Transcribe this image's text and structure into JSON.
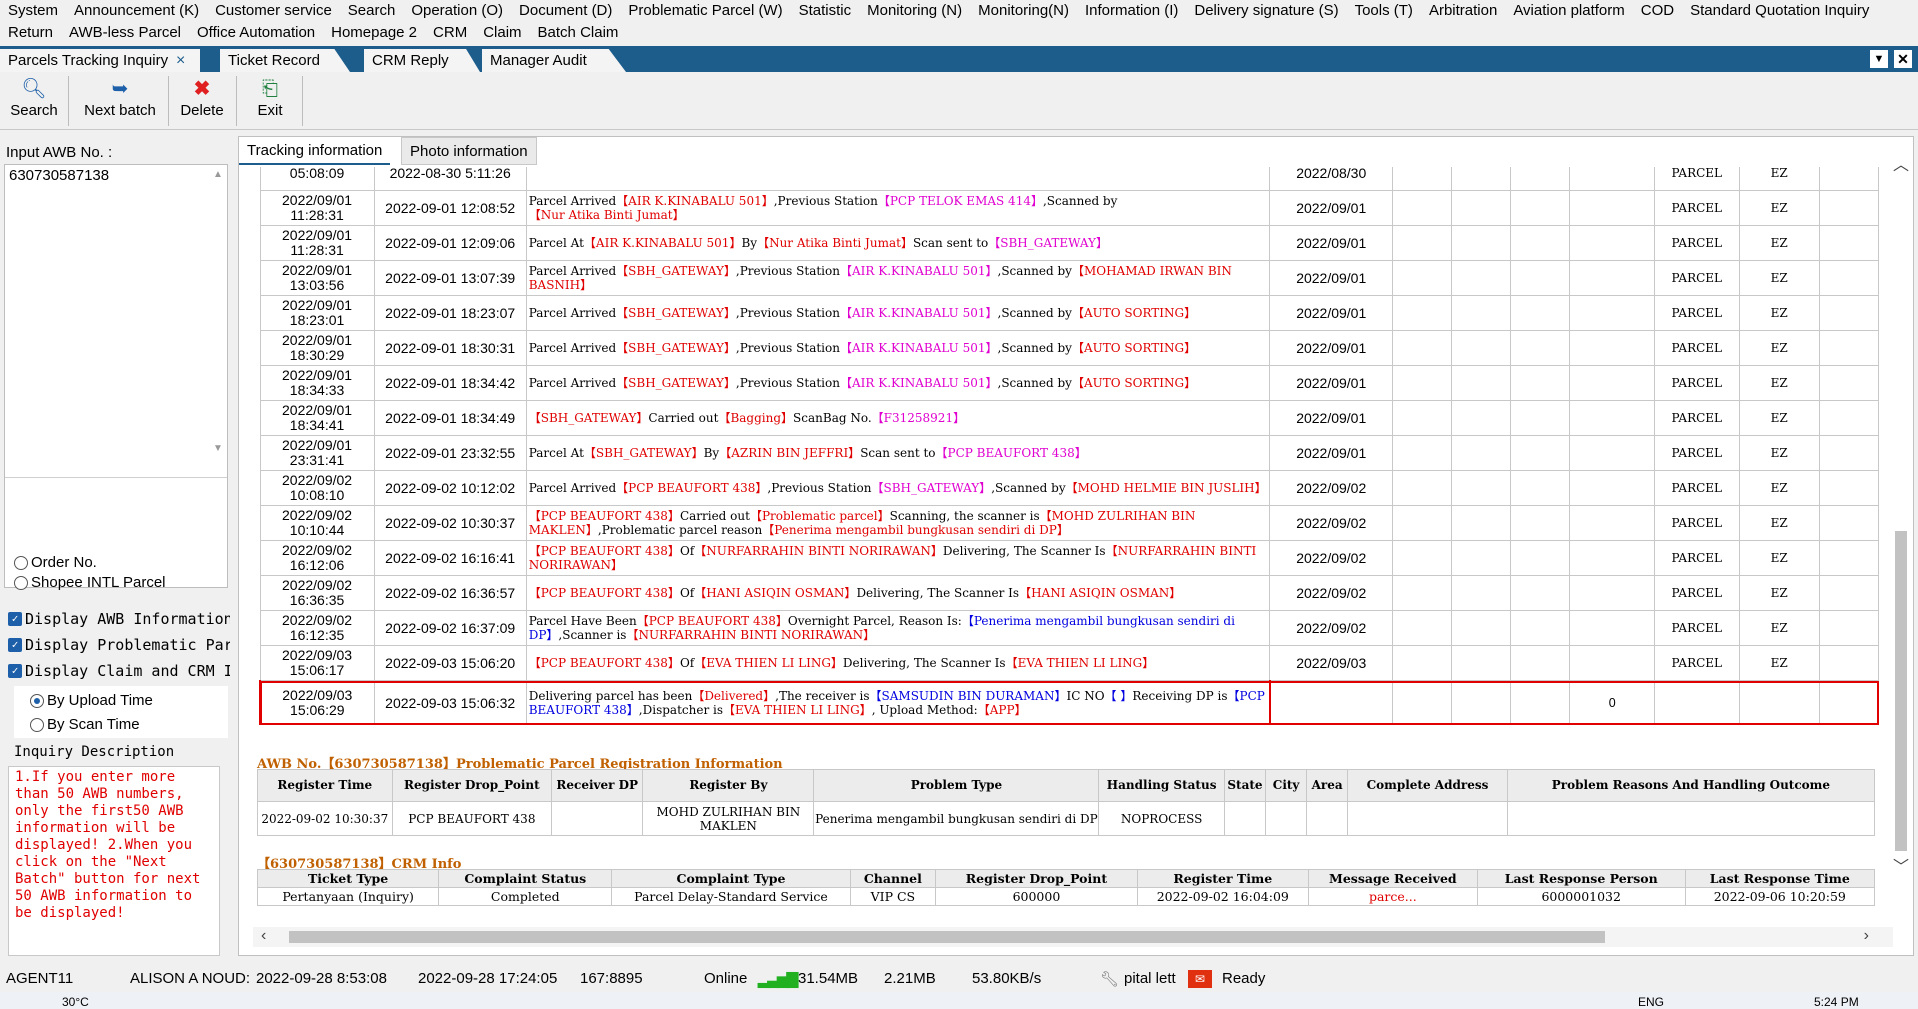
{
  "menu": {
    "row1": [
      "System",
      "Announcement (K)",
      "Customer service",
      "Search",
      "Operation (O)",
      "Document (D)",
      "Problematic Parcel (W)",
      "Statistic",
      "Monitoring (N)",
      "Monitoring(N)",
      "Information (I)",
      "Delivery signature (S)",
      "Tools (T)",
      "Arbitration",
      "Aviation platform",
      "COD",
      "Standard Quotation Inquiry"
    ],
    "row2": [
      "Return",
      "AWB-less Parcel",
      "Office Automation",
      "Homepage 2",
      "CRM",
      "Claim",
      "Batch Claim"
    ]
  },
  "tabs": {
    "active": "Parcels Tracking Inquiry",
    "others": [
      "Ticket Record",
      "CRM Reply",
      "Manager Audit"
    ],
    "close_icon": "×"
  },
  "toolbar": {
    "search": "Search",
    "next_batch": "Next batch",
    "delete": "Delete",
    "exit": "Exit"
  },
  "left": {
    "awb_label": "Input AWB No. :",
    "awb_value": "630730587138",
    "order_no": "Order No.",
    "shopee": "Shopee INTL Parcel",
    "chk_awb": "Display AWB Information",
    "chk_problematic": "Display Problematic Par",
    "chk_claim": "Display Claim and CRM I",
    "by_upload": "By Upload Time",
    "by_scan": "By Scan Time",
    "inquiry_title": "Inquiry Description",
    "inquiry_text": "1.If you enter more than  50  AWB numbers, only the first50  AWB information will be displayed! 2.When you click on the \"Next Batch\" button for next  50  AWB information to be displayed!"
  },
  "subtabs": [
    "Tracking information",
    "Photo information"
  ],
  "tracking": {
    "partial_row": {
      "upload": "05:08:09",
      "scan": "2022-08-30 5:11:26",
      "date": "2022/08/30",
      "type": "PARCEL",
      "code": "EZ"
    },
    "rows": [
      {
        "upload1": "2022/09/01",
        "upload2": "11:28:31",
        "scan": "2022-09-01 12:08:52",
        "date": "2022/09/01",
        "type": "PARCEL",
        "code": "EZ",
        "desc": [
          [
            "t",
            "Parcel Arrived"
          ],
          [
            "r",
            "【AIR K.KINABALU 501】"
          ],
          [
            "t",
            ",Previous Station"
          ],
          [
            "m",
            "【PCP TELOK EMAS 414】"
          ],
          [
            "t",
            ",Scanned by"
          ],
          [
            "r",
            "【Nur Atika Binti Jumat】"
          ]
        ]
      },
      {
        "upload1": "2022/09/01",
        "upload2": "11:28:31",
        "scan": "2022-09-01 12:09:06",
        "date": "2022/09/01",
        "type": "PARCEL",
        "code": "EZ",
        "desc": [
          [
            "t",
            "Parcel At"
          ],
          [
            "r",
            "【AIR K.KINABALU 501】"
          ],
          [
            "t",
            "By"
          ],
          [
            "r",
            "【Nur Atika Binti Jumat】"
          ],
          [
            "t",
            "Scan sent to"
          ],
          [
            "m",
            "【SBH_GATEWAY】"
          ]
        ]
      },
      {
        "upload1": "2022/09/01",
        "upload2": "13:03:56",
        "scan": "2022-09-01 13:07:39",
        "date": "2022/09/01",
        "type": "PARCEL",
        "code": "EZ",
        "desc": [
          [
            "t",
            "Parcel Arrived"
          ],
          [
            "r",
            "【SBH_GATEWAY】"
          ],
          [
            "t",
            ",Previous Station"
          ],
          [
            "m",
            "【AIR K.KINABALU 501】"
          ],
          [
            "t",
            ",Scanned by"
          ],
          [
            "r",
            "【MOHAMAD IRWAN BIN BASNIH】"
          ]
        ]
      },
      {
        "upload1": "2022/09/01",
        "upload2": "18:23:01",
        "scan": "2022-09-01 18:23:07",
        "date": "2022/09/01",
        "type": "PARCEL",
        "code": "EZ",
        "desc": [
          [
            "t",
            "Parcel Arrived"
          ],
          [
            "r",
            "【SBH_GATEWAY】"
          ],
          [
            "t",
            ",Previous Station"
          ],
          [
            "m",
            "【AIR K.KINABALU 501】"
          ],
          [
            "t",
            ",Scanned by"
          ],
          [
            "r",
            "【AUTO SORTING】"
          ]
        ]
      },
      {
        "upload1": "2022/09/01",
        "upload2": "18:30:29",
        "scan": "2022-09-01 18:30:31",
        "date": "2022/09/01",
        "type": "PARCEL",
        "code": "EZ",
        "desc": [
          [
            "t",
            "Parcel Arrived"
          ],
          [
            "r",
            "【SBH_GATEWAY】"
          ],
          [
            "t",
            ",Previous Station"
          ],
          [
            "m",
            "【AIR K.KINABALU 501】"
          ],
          [
            "t",
            ",Scanned by"
          ],
          [
            "r",
            "【AUTO SORTING】"
          ]
        ]
      },
      {
        "upload1": "2022/09/01",
        "upload2": "18:34:33",
        "scan": "2022-09-01 18:34:42",
        "date": "2022/09/01",
        "type": "PARCEL",
        "code": "EZ",
        "desc": [
          [
            "t",
            "Parcel Arrived"
          ],
          [
            "r",
            "【SBH_GATEWAY】"
          ],
          [
            "t",
            ",Previous Station"
          ],
          [
            "m",
            "【AIR K.KINABALU 501】"
          ],
          [
            "t",
            ",Scanned by"
          ],
          [
            "r",
            "【AUTO SORTING】"
          ]
        ]
      },
      {
        "upload1": "2022/09/01",
        "upload2": "18:34:41",
        "scan": "2022-09-01 18:34:49",
        "date": "2022/09/01",
        "type": "PARCEL",
        "code": "EZ",
        "desc": [
          [
            "r",
            "【SBH_GATEWAY】"
          ],
          [
            "t",
            "Carried out"
          ],
          [
            "r",
            "【Bagging】"
          ],
          [
            "t",
            "ScanBag No."
          ],
          [
            "m",
            "【F31258921】"
          ]
        ]
      },
      {
        "upload1": "2022/09/01",
        "upload2": "23:31:41",
        "scan": "2022-09-01 23:32:55",
        "date": "2022/09/01",
        "type": "PARCEL",
        "code": "EZ",
        "desc": [
          [
            "t",
            "Parcel At"
          ],
          [
            "r",
            "【SBH_GATEWAY】"
          ],
          [
            "t",
            "By"
          ],
          [
            "r",
            "【AZRIN BIN JEFFRI】"
          ],
          [
            "t",
            "Scan sent to"
          ],
          [
            "m",
            "【PCP BEAUFORT 438】"
          ]
        ]
      },
      {
        "upload1": "2022/09/02",
        "upload2": "10:08:10",
        "scan": "2022-09-02 10:12:02",
        "date": "2022/09/02",
        "type": "PARCEL",
        "code": "EZ",
        "desc": [
          [
            "t",
            "Parcel Arrived"
          ],
          [
            "r",
            "【PCP BEAUFORT 438】"
          ],
          [
            "t",
            ",Previous Station"
          ],
          [
            "m",
            "【SBH_GATEWAY】"
          ],
          [
            "t",
            ",Scanned by"
          ],
          [
            "r",
            "【MOHD HELMIE BIN JUSLIH】"
          ]
        ]
      },
      {
        "upload1": "2022/09/02",
        "upload2": "10:10:44",
        "scan": "2022-09-02 10:30:37",
        "date": "2022/09/02",
        "type": "PARCEL",
        "code": "EZ",
        "desc": [
          [
            "r",
            "【PCP BEAUFORT 438】"
          ],
          [
            "t",
            "Carried out"
          ],
          [
            "r",
            "【Problematic parcel】"
          ],
          [
            "t",
            "Scanning, the scanner is"
          ],
          [
            "r",
            "【MOHD ZULRIHAN BIN MAKLEN】"
          ],
          [
            "t",
            ",Problematic parcel reason"
          ],
          [
            "r",
            "【Penerima mengambil bungkusan sendiri di DP】"
          ]
        ]
      },
      {
        "upload1": "2022/09/02",
        "upload2": "16:12:06",
        "scan": "2022-09-02 16:16:41",
        "date": "2022/09/02",
        "type": "PARCEL",
        "code": "EZ",
        "desc": [
          [
            "r",
            "【PCP BEAUFORT 438】"
          ],
          [
            "t",
            "Of"
          ],
          [
            "r",
            "【NURFARRAHIN BINTI NORIRAWAN】"
          ],
          [
            "t",
            "Delivering, The Scanner Is"
          ],
          [
            "r",
            "【NURFARRAHIN BINTI NORIRAWAN】"
          ]
        ]
      },
      {
        "upload1": "2022/09/02",
        "upload2": "16:36:35",
        "scan": "2022-09-02 16:36:57",
        "date": "2022/09/02",
        "type": "PARCEL",
        "code": "EZ",
        "desc": [
          [
            "r",
            "【PCP BEAUFORT 438】"
          ],
          [
            "t",
            "Of"
          ],
          [
            "r",
            "【HANI ASIQIN OSMAN】"
          ],
          [
            "t",
            "Delivering, The Scanner Is"
          ],
          [
            "r",
            "【HANI ASIQIN OSMAN】"
          ]
        ]
      },
      {
        "upload1": "2022/09/02",
        "upload2": "16:12:35",
        "scan": "2022-09-02 16:37:09",
        "date": "2022/09/02",
        "type": "PARCEL",
        "code": "EZ",
        "desc": [
          [
            "t",
            "Parcel Have Been"
          ],
          [
            "r",
            "【PCP BEAUFORT 438】"
          ],
          [
            "t",
            "Overnight Parcel, Reason Is:"
          ],
          [
            "b",
            "【Penerima mengambil bungkusan sendiri di DP】"
          ],
          [
            "t",
            ",Scanner is"
          ],
          [
            "r",
            "【NURFARRAHIN BINTI NORIRAWAN】"
          ]
        ]
      },
      {
        "upload1": "2022/09/03",
        "upload2": "15:06:17",
        "scan": "2022-09-03 15:06:20",
        "date": "2022/09/03",
        "type": "PARCEL",
        "code": "EZ",
        "desc": [
          [
            "r",
            "【PCP BEAUFORT 438】"
          ],
          [
            "t",
            "Of"
          ],
          [
            "r",
            "【EVA THIEN LI LING】"
          ],
          [
            "t",
            "Delivering, The Scanner Is"
          ],
          [
            "r",
            "【EVA THIEN LI LING】"
          ]
        ]
      }
    ],
    "delivered_row": {
      "upload1": "2022/09/03",
      "upload2": "15:06:29",
      "scan": "2022-09-03 15:06:32",
      "num": "0",
      "desc": [
        [
          "t",
          "Delivering parcel has been"
        ],
        [
          "r",
          "【Delivered】"
        ],
        [
          "t",
          ",The receiver is"
        ],
        [
          "b",
          "【SAMSUDIN BIN DURAMAN】"
        ],
        [
          "t",
          "IC NO"
        ],
        [
          "b",
          "【 】"
        ],
        [
          "t",
          "Receiving DP is"
        ],
        [
          "b",
          "【PCP BEAUFORT 438】"
        ],
        [
          "t",
          ",Dispatcher is"
        ],
        [
          "r",
          "【EVA THIEN LI LING】"
        ],
        [
          "t",
          ", Upload Method:"
        ],
        [
          "r",
          "【APP】"
        ]
      ]
    }
  },
  "problem_section": {
    "title": "AWB No.【630730587138】Problematic Parcel Registration Information",
    "headers": [
      "Register Time",
      "Register Drop_Point",
      "Receiver DP",
      "Register By",
      "Problem Type",
      "Handling Status",
      "State",
      "City",
      "Area",
      "Complete Address",
      "Problem Reasons And Handling Outcome"
    ],
    "row": [
      "2022-09-02 10:30:37",
      "PCP BEAUFORT 438",
      "",
      "MOHD ZULRIHAN BIN MAKLEN",
      "Penerima mengambil bungkusan sendiri di DP",
      "NOPROCESS",
      "",
      "",
      "",
      "",
      ""
    ]
  },
  "crm_section": {
    "title": "【630730587138】CRM Info",
    "headers": [
      "Ticket Type",
      "Complaint Status",
      "Complaint Type",
      "Channel",
      "Register Drop_Point",
      "Register Time",
      "Message Received",
      "Last Response Person",
      "Last Response Time"
    ],
    "row": [
      "Pertanyaan (Inquiry)",
      "Completed",
      "Parcel Delay-Standard Service",
      "VIP CS",
      "600000",
      "2022-09-02 16:04:09",
      "parce...",
      "6000001032",
      "2022-09-06 10:20:59"
    ]
  },
  "status": {
    "user": "AGENT11",
    "name": "ALISON A NOUD:",
    "time1": "2022-09-28 8:53:08",
    "time2": "2022-09-28 17:24:05",
    "port": "167:8895",
    "online": "Online",
    "mem1": "31.54MB",
    "mem2": "2.21MB",
    "speed": "53.80KB/s",
    "tool": "pital lett",
    "ready": "Ready"
  },
  "taskbar": {
    "weather": "30°C",
    "lang": "ENG",
    "clock": "5:24 PM"
  },
  "colors": {
    "tab_strip": "#1c5d8c",
    "red": "#e00000",
    "magenta": "#e000d0",
    "blue": "#0000e0",
    "section_title": "#c06000",
    "highlight": "#e00000"
  }
}
